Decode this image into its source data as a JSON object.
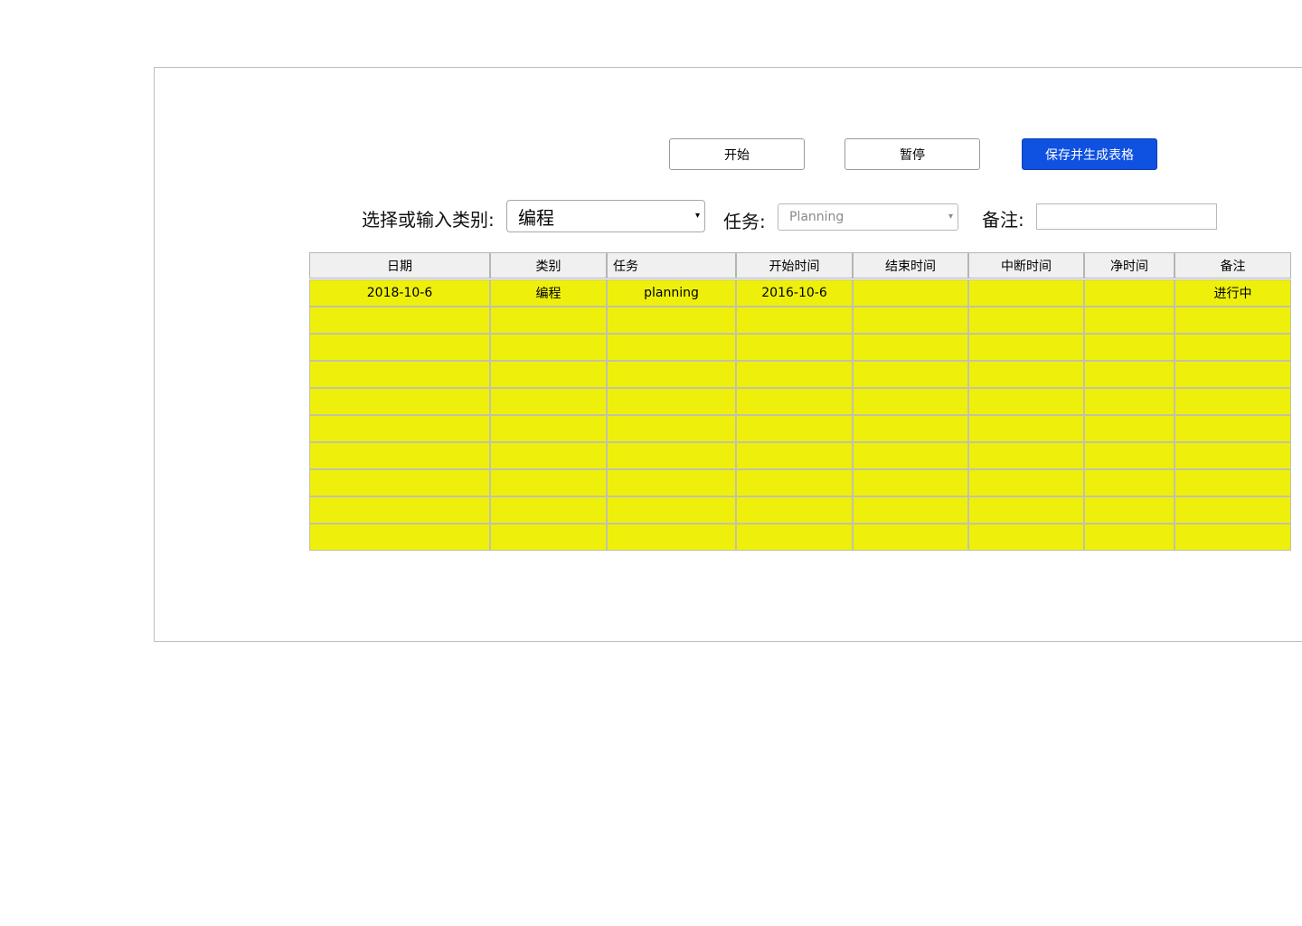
{
  "toolbar": {
    "start_label": "开始",
    "pause_label": "暂停",
    "save_label": "保存并生成表格"
  },
  "form": {
    "category_label": "选择或输入类别:",
    "category_value": "编程",
    "task_label": "任务:",
    "task_placeholder": "Planning",
    "note_label": "备注:",
    "note_value": ""
  },
  "table": {
    "headers": [
      "日期",
      "类别",
      "任务",
      "开始时间",
      "结束时间",
      "中断时间",
      "净时间",
      "备注"
    ],
    "rows": [
      [
        "2018-10-6",
        "编程",
        "planning",
        "2016-10-6",
        "",
        "",
        "",
        "进行中"
      ],
      [
        "",
        "",
        "",
        "",
        "",
        "",
        "",
        ""
      ],
      [
        "",
        "",
        "",
        "",
        "",
        "",
        "",
        ""
      ],
      [
        "",
        "",
        "",
        "",
        "",
        "",
        "",
        ""
      ],
      [
        "",
        "",
        "",
        "",
        "",
        "",
        "",
        ""
      ],
      [
        "",
        "",
        "",
        "",
        "",
        "",
        "",
        ""
      ],
      [
        "",
        "",
        "",
        "",
        "",
        "",
        "",
        ""
      ],
      [
        "",
        "",
        "",
        "",
        "",
        "",
        "",
        ""
      ],
      [
        "",
        "",
        "",
        "",
        "",
        "",
        "",
        ""
      ],
      [
        "",
        "",
        "",
        "",
        "",
        "",
        "",
        ""
      ]
    ]
  },
  "colors": {
    "cell_fill": "#eef00c",
    "header_fill": "#f0f0f0",
    "primary_button": "#0f51e0"
  }
}
